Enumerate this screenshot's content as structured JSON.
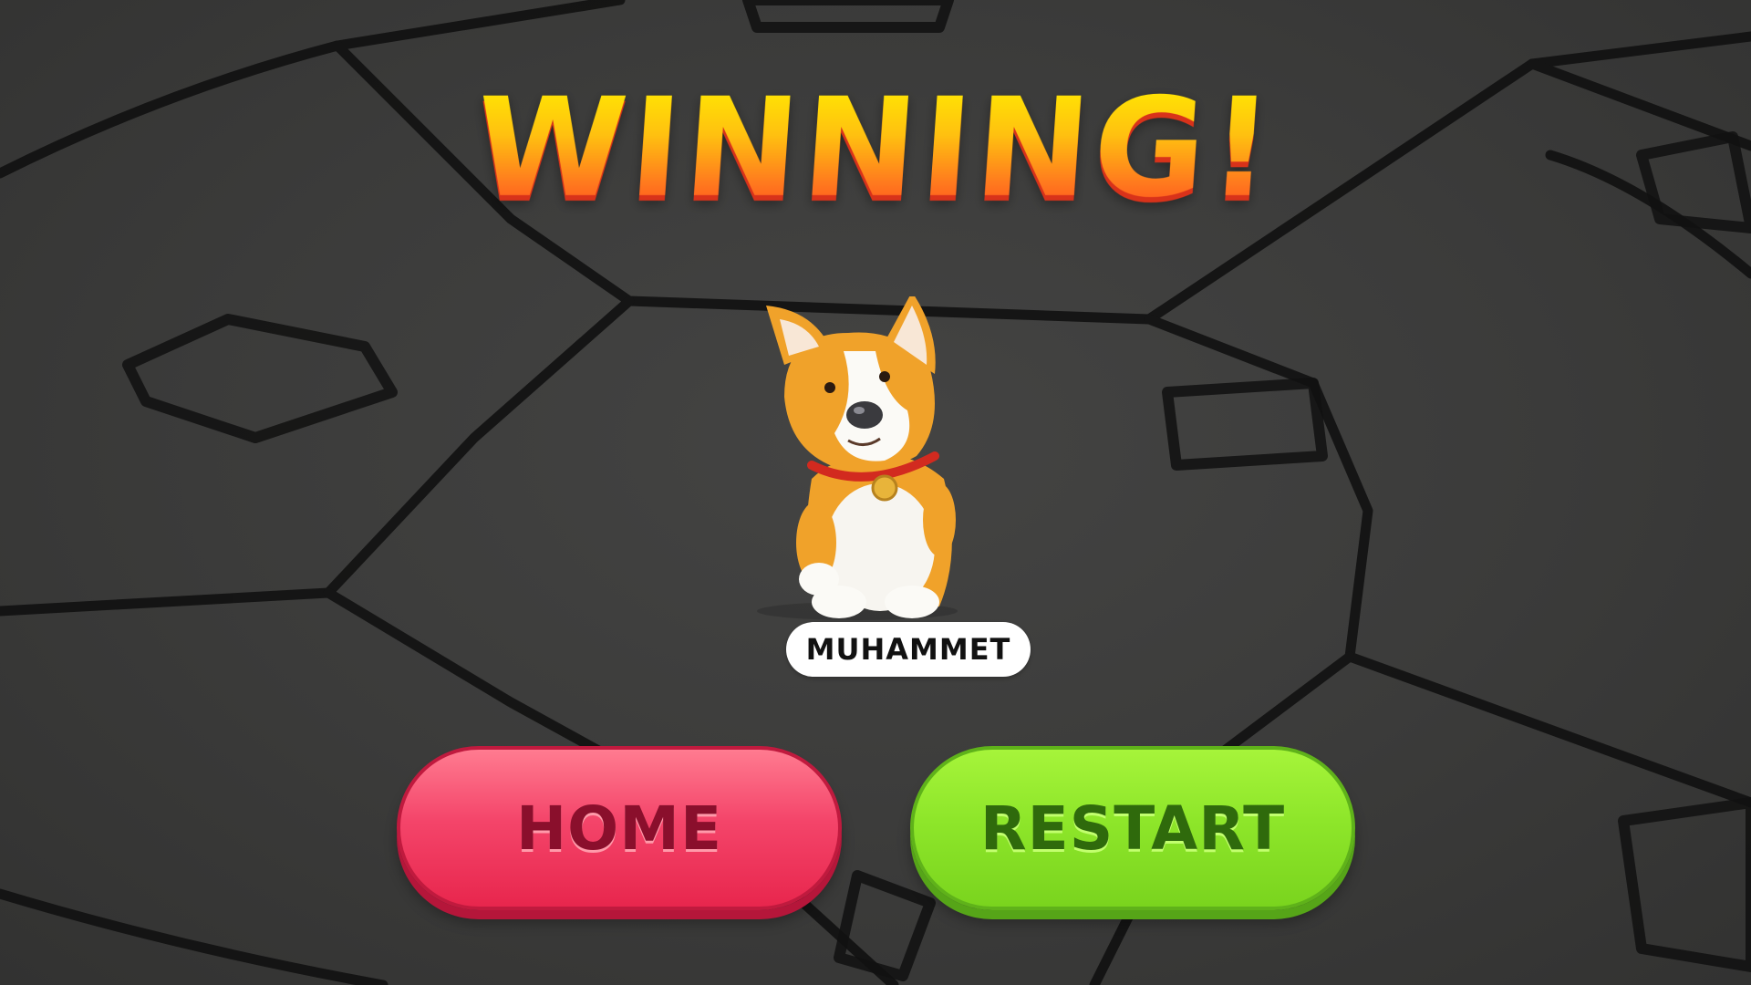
{
  "screen": {
    "title": "WINNING!",
    "player_name": "MUHAMMET",
    "character": "corgi-dog"
  },
  "buttons": {
    "home_label": "HOME",
    "restart_label": "RESTART"
  },
  "colors": {
    "background": "#3a3a39",
    "title_top": "#ffec00",
    "title_bottom": "#ff4a1e",
    "home_button": "#f4456a",
    "restart_button": "#8ee62a"
  }
}
